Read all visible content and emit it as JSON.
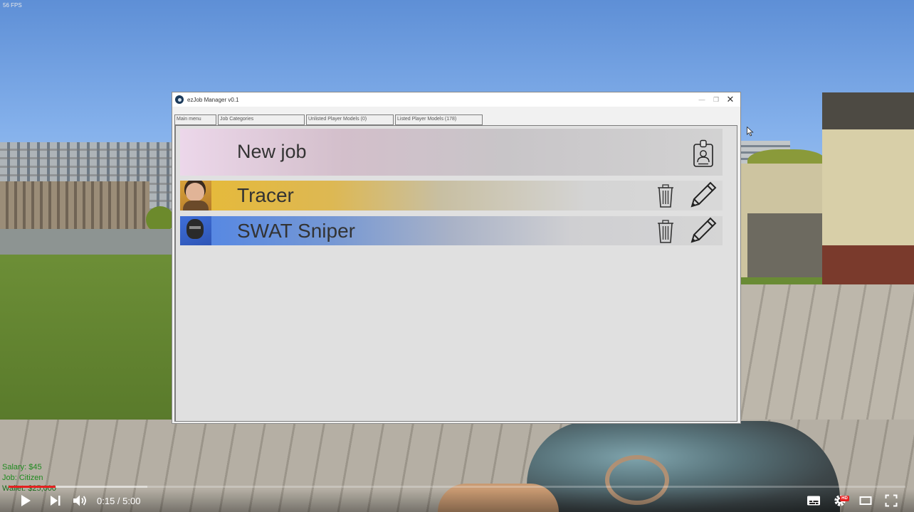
{
  "overlay": {
    "fps": "56 FPS"
  },
  "hud": {
    "salary": "Salary: $45",
    "job": "Job: Citizen",
    "wallet": "Wallet: $25,000"
  },
  "window": {
    "title": "ezJob Manager v0.1",
    "minimize_icon": "—",
    "maximize_icon": "❐",
    "close_icon": "✕"
  },
  "tabs": [
    {
      "label": "Main menu"
    },
    {
      "label": "Job Categories"
    },
    {
      "label": "Unlisted Player Models (0)"
    },
    {
      "label": "Listed Player Models (178)"
    }
  ],
  "jobs": {
    "new_job_label": "New job",
    "items": [
      {
        "name": "Tracer",
        "color": "#e7ba36"
      },
      {
        "name": "SWAT Sniper",
        "color": "#4f84e6"
      }
    ]
  },
  "player": {
    "time": "0:15 / 5:00",
    "hd_badge": "HD",
    "accent": "#e52020"
  }
}
